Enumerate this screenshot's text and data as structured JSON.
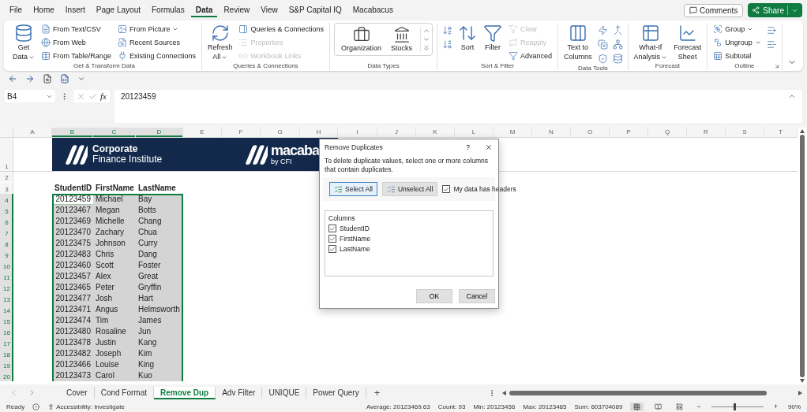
{
  "menu": {
    "tabs": [
      {
        "label": "File",
        "selected": false
      },
      {
        "label": "Home",
        "selected": false
      },
      {
        "label": "Insert",
        "selected": false
      },
      {
        "label": "Page Layout",
        "selected": false
      },
      {
        "label": "Formulas",
        "selected": false
      },
      {
        "label": "Data",
        "selected": true
      },
      {
        "label": "Review",
        "selected": false
      },
      {
        "label": "View",
        "selected": false
      },
      {
        "label": "S&P Capital IQ",
        "selected": false
      },
      {
        "label": "Macabacus",
        "selected": false
      }
    ],
    "comments_button": "Comments",
    "share_button": "Share"
  },
  "ribbon": {
    "groups": [
      {
        "label": "Get & Transform Data",
        "launcher": false,
        "items": [
          {
            "kind": "large",
            "lines": [
              "Get",
              "Data"
            ],
            "dropdown": true
          },
          {
            "kind": "stack",
            "entries": [
              {
                "label": "From Text/CSV",
                "disabled": false,
                "dropdown": false
              },
              {
                "label": "From Web",
                "disabled": false,
                "dropdown": false
              },
              {
                "label": "From Table/Range",
                "disabled": false,
                "dropdown": false
              }
            ]
          },
          {
            "kind": "stack",
            "entries": [
              {
                "label": "From Picture",
                "disabled": false,
                "dropdown": true
              },
              {
                "label": "Recent Sources",
                "disabled": false,
                "dropdown": false
              },
              {
                "label": "Existing Connections",
                "disabled": false,
                "dropdown": false
              }
            ]
          }
        ]
      },
      {
        "label": "Queries & Connections",
        "launcher": false,
        "items": [
          {
            "kind": "large",
            "lines": [
              "Refresh",
              "All"
            ],
            "dropdown": true
          },
          {
            "kind": "stack",
            "entries": [
              {
                "label": "Queries & Connections",
                "disabled": false,
                "dropdown": false
              },
              {
                "label": "Properties",
                "disabled": true,
                "dropdown": false
              },
              {
                "label": "Workbook Links",
                "disabled": true,
                "dropdown": false
              }
            ]
          }
        ]
      },
      {
        "label": "Data Types",
        "launcher": false,
        "items": [
          {
            "kind": "gallery",
            "entries": [
              {
                "label": "Organization"
              },
              {
                "label": "Stocks"
              }
            ]
          }
        ]
      },
      {
        "label": "Sort & Filter",
        "launcher": false,
        "items": [
          {
            "kind": "icon_stack"
          },
          {
            "kind": "large",
            "lines": [
              "Sort"
            ],
            "dropdown": false
          },
          {
            "kind": "large",
            "lines": [
              "Filter"
            ],
            "dropdown": false
          },
          {
            "kind": "stack",
            "entries": [
              {
                "label": "Clear",
                "disabled": true,
                "dropdown": false
              },
              {
                "label": "Reapply",
                "disabled": true,
                "dropdown": false
              },
              {
                "label": "Advanced",
                "disabled": false,
                "dropdown": false
              }
            ]
          }
        ]
      },
      {
        "label": "Data Tools",
        "launcher": false,
        "items": [
          {
            "kind": "large",
            "lines": [
              "Text to",
              "Columns"
            ],
            "dropdown": false
          },
          {
            "kind": "icon_stack"
          },
          {
            "kind": "icon_stack"
          }
        ]
      },
      {
        "label": "Forecast",
        "launcher": false,
        "items": [
          {
            "kind": "large",
            "lines": [
              "What-If",
              "Analysis"
            ],
            "dropdown": true
          },
          {
            "kind": "large",
            "lines": [
              "Forecast",
              "Sheet"
            ],
            "dropdown": false
          }
        ]
      },
      {
        "label": "Outline",
        "launcher": true,
        "items": [
          {
            "kind": "stack",
            "entries": [
              {
                "label": "Group",
                "disabled": false,
                "dropdown": true
              },
              {
                "label": "Ungroup",
                "disabled": false,
                "dropdown": true
              },
              {
                "label": "Subtotal",
                "disabled": false,
                "dropdown": false
              }
            ]
          },
          {
            "kind": "icon_stack"
          }
        ]
      }
    ]
  },
  "formula_bar": {
    "name_box": "B4",
    "function_label": "fx",
    "value": "20123459"
  },
  "sheet": {
    "columns": [
      {
        "label": "A",
        "selected": false
      },
      {
        "label": "B",
        "selected": true
      },
      {
        "label": "C",
        "selected": true
      },
      {
        "label": "D",
        "selected": true
      },
      {
        "label": "E",
        "selected": false
      },
      {
        "label": "F",
        "selected": false
      },
      {
        "label": "G",
        "selected": false
      },
      {
        "label": "H",
        "selected": false
      },
      {
        "label": "I",
        "selected": false
      },
      {
        "label": "J",
        "selected": false
      },
      {
        "label": "K",
        "selected": false
      },
      {
        "label": "L",
        "selected": false
      },
      {
        "label": "M",
        "selected": false
      },
      {
        "label": "N",
        "selected": false
      },
      {
        "label": "O",
        "selected": false
      },
      {
        "label": "P",
        "selected": false
      },
      {
        "label": "Q",
        "selected": false
      },
      {
        "label": "R",
        "selected": false
      },
      {
        "label": "S",
        "selected": false
      },
      {
        "label": "T",
        "selected": false
      }
    ],
    "banner": {
      "left_title": "Corporate",
      "left_subtitle": "Finance Institute",
      "right_title": "macaba",
      "right_subtitle": "by CFI"
    },
    "rows": [
      {
        "number": "1",
        "kind": "banner",
        "selected": false
      },
      {
        "number": "2",
        "kind": "empty",
        "selected": false
      },
      {
        "number": "3",
        "kind": "header",
        "selected": false,
        "cells": [
          "StudentID",
          "FirstName",
          "LastName"
        ]
      },
      {
        "number": "4",
        "kind": "data",
        "selected": true,
        "active": true,
        "cells": [
          "20123459",
          "Michael",
          "Bay"
        ]
      },
      {
        "number": "5",
        "kind": "data",
        "selected": true,
        "active": false,
        "cells": [
          "20123467",
          "Megan",
          "Botts"
        ]
      },
      {
        "number": "6",
        "kind": "data",
        "selected": true,
        "active": false,
        "cells": [
          "20123469",
          "Michelle",
          "Chang"
        ]
      },
      {
        "number": "7",
        "kind": "data",
        "selected": true,
        "active": false,
        "cells": [
          "20123470",
          "Zachary",
          "Chua"
        ]
      },
      {
        "number": "8",
        "kind": "data",
        "selected": true,
        "active": false,
        "cells": [
          "20123475",
          "Johnson",
          "Curry"
        ]
      },
      {
        "number": "9",
        "kind": "data",
        "selected": true,
        "active": false,
        "cells": [
          "20123483",
          "Chris",
          "Dang"
        ]
      },
      {
        "number": "10",
        "kind": "data",
        "selected": true,
        "active": false,
        "cells": [
          "20123460",
          "Scott",
          "Foster"
        ]
      },
      {
        "number": "11",
        "kind": "data",
        "selected": true,
        "active": false,
        "cells": [
          "20123457",
          "Alex",
          "Great"
        ]
      },
      {
        "number": "12",
        "kind": "data",
        "selected": true,
        "active": false,
        "cells": [
          "20123465",
          "Peter",
          "Gryffin"
        ]
      },
      {
        "number": "13",
        "kind": "data",
        "selected": true,
        "active": false,
        "cells": [
          "20123477",
          "Josh",
          "Hart"
        ]
      },
      {
        "number": "14",
        "kind": "data",
        "selected": true,
        "active": false,
        "cells": [
          "20123471",
          "Angus",
          "Helmsworth"
        ]
      },
      {
        "number": "15",
        "kind": "data",
        "selected": true,
        "active": false,
        "cells": [
          "20123474",
          "Tim",
          "James"
        ]
      },
      {
        "number": "16",
        "kind": "data",
        "selected": true,
        "active": false,
        "cells": [
          "20123480",
          "Rosaline",
          "Jun"
        ]
      },
      {
        "number": "17",
        "kind": "data",
        "selected": true,
        "active": false,
        "cells": [
          "20123478",
          "Justin",
          "Kang"
        ]
      },
      {
        "number": "18",
        "kind": "data",
        "selected": true,
        "active": false,
        "cells": [
          "20123482",
          "Joseph",
          "Kim"
        ]
      },
      {
        "number": "19",
        "kind": "data",
        "selected": true,
        "active": false,
        "cells": [
          "20123466",
          "Louise",
          "King"
        ]
      },
      {
        "number": "20",
        "kind": "data",
        "selected": true,
        "active": false,
        "cells": [
          "20123473",
          "Carol",
          "Kuo"
        ]
      }
    ]
  },
  "dialog": {
    "title": "Remove Duplicates",
    "help": "?",
    "description": "To delete duplicate values, select one or more columns that contain duplicates.",
    "select_all": "Select All",
    "unselect_all": "Unselect All",
    "headers_option": {
      "label": "My data has headers",
      "checked": true
    },
    "columns_label": "Columns",
    "columns": [
      {
        "label": "StudentID",
        "checked": true
      },
      {
        "label": "FirstName",
        "checked": true
      },
      {
        "label": "LastName",
        "checked": true
      }
    ],
    "ok": "OK",
    "cancel": "Cancel"
  },
  "sheet_tabs": [
    {
      "label": "Cover",
      "selected": false
    },
    {
      "label": "Cond Format",
      "selected": false
    },
    {
      "label": "Remove Dup",
      "selected": true
    },
    {
      "label": "Adv Filter",
      "selected": false
    },
    {
      "label": "UNIQUE",
      "selected": false
    },
    {
      "label": "Power Query",
      "selected": false
    }
  ],
  "add_sheet": "+",
  "status_bar": {
    "mode": "Ready",
    "accessibility": "Accessibility: Investigate",
    "stats": [
      "Average: 20123469.63",
      "Count: 93",
      "Min: 20123456",
      "Max: 20123485",
      "Sum: 603704089"
    ],
    "views": [
      {
        "selected": true
      },
      {
        "selected": false
      },
      {
        "selected": false
      }
    ],
    "zoom": {
      "minus": "−",
      "plus": "+",
      "level": 0.45,
      "reading": "90%"
    }
  }
}
